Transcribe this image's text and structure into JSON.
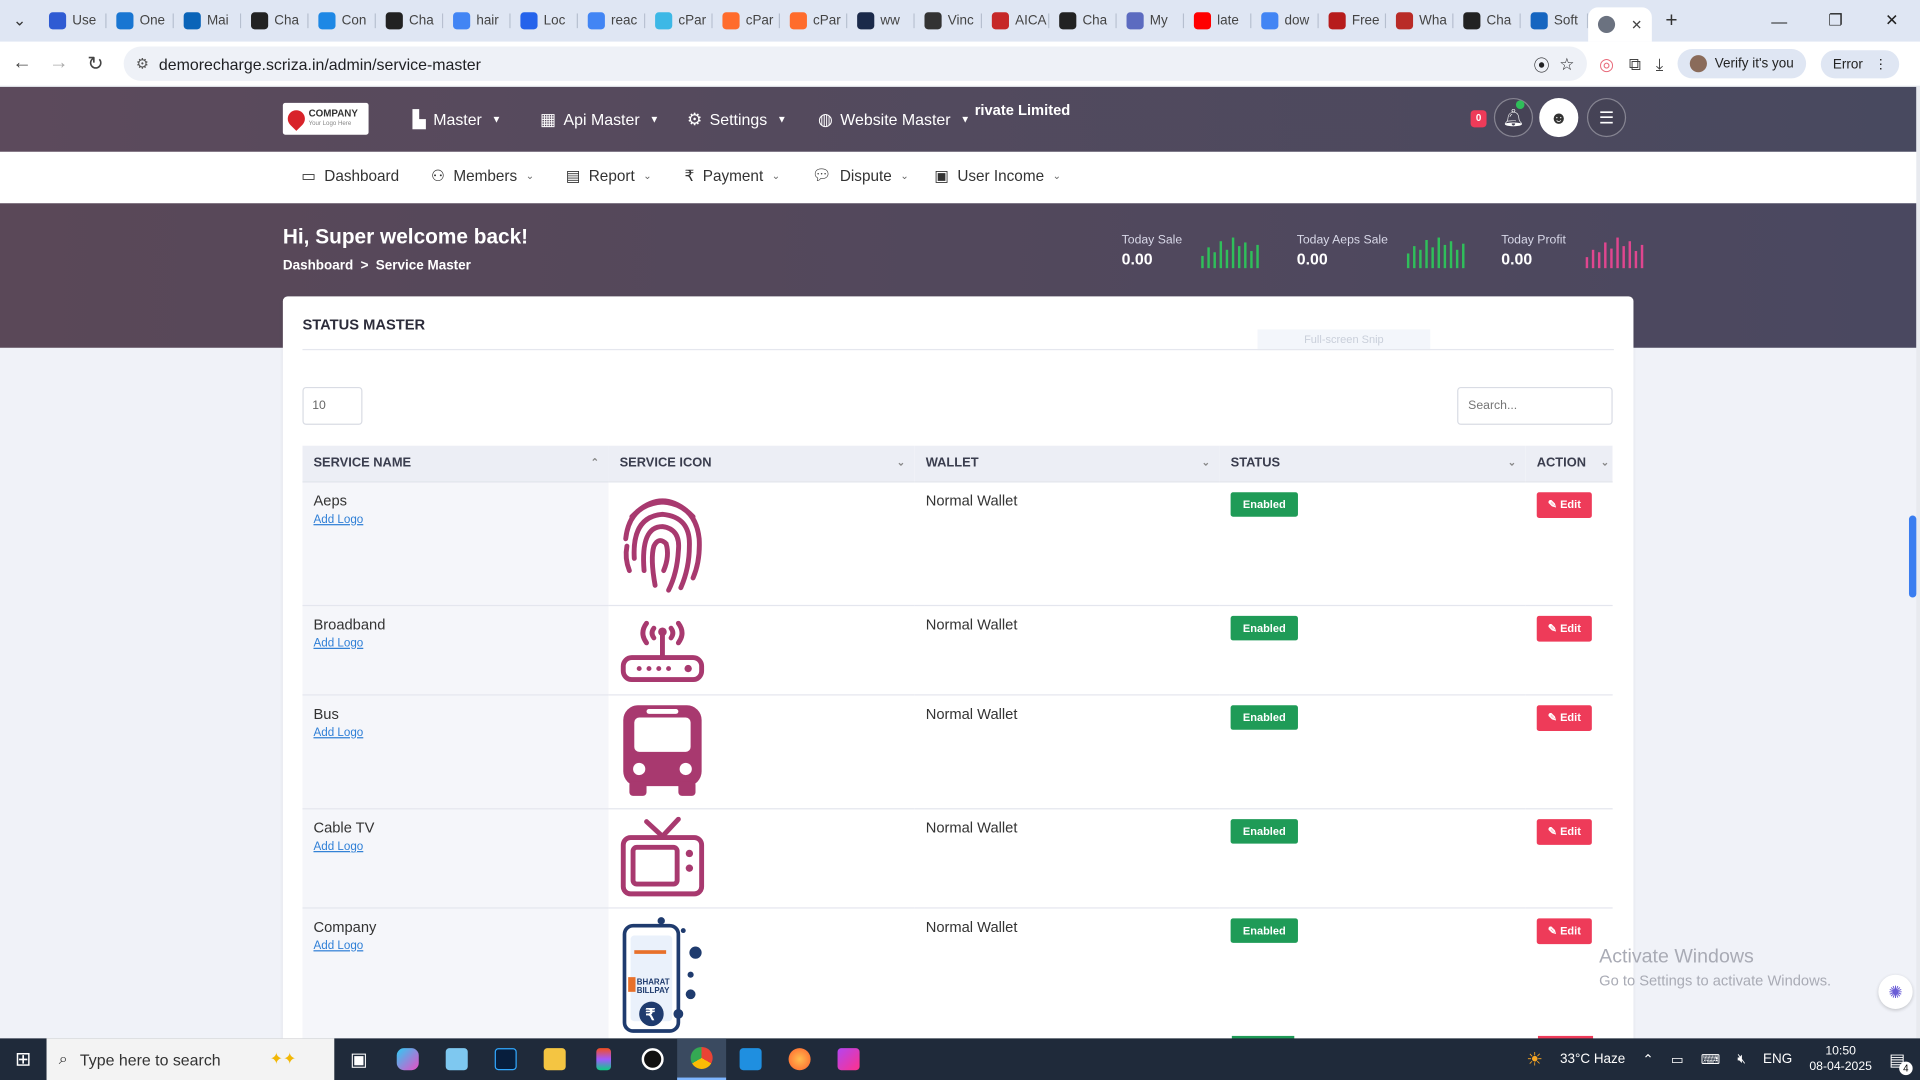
{
  "browser": {
    "tabs": [
      {
        "label": "Use",
        "color": "#2f5bd3"
      },
      {
        "label": "One",
        "color": "#1976d2"
      },
      {
        "label": "Mai",
        "color": "#0a64b8"
      },
      {
        "label": "Cha",
        "color": "#222222"
      },
      {
        "label": "Con",
        "color": "#1e88e5"
      },
      {
        "label": "Cha",
        "color": "#222222"
      },
      {
        "label": "hair",
        "color": "#4285f4"
      },
      {
        "label": "Loc",
        "color": "#2563eb"
      },
      {
        "label": "reac",
        "color": "#4285f4"
      },
      {
        "label": "cPar",
        "color": "#3db8e6"
      },
      {
        "label": "cPar",
        "color": "#ff6c2c"
      },
      {
        "label": "cPar",
        "color": "#ff6c2c"
      },
      {
        "label": "ww",
        "color": "#1b2a4a"
      },
      {
        "label": "Vinc",
        "color": "#333333"
      },
      {
        "label": "AICA",
        "color": "#c62828"
      },
      {
        "label": "Cha",
        "color": "#222222"
      },
      {
        "label": "My",
        "color": "#5c6bc0"
      },
      {
        "label": "late",
        "color": "#ff0000"
      },
      {
        "label": "dow",
        "color": "#4285f4"
      },
      {
        "label": "Free",
        "color": "#b71c1c"
      },
      {
        "label": "Wha",
        "color": "#b92b27"
      },
      {
        "label": "Cha",
        "color": "#222222"
      },
      {
        "label": "Soft",
        "color": "#1565c0"
      }
    ],
    "active_tab_close": "✕",
    "new_tab": "+",
    "url": "demorecharge.scriza.in/admin/service-master",
    "verify_label": "Verify it's you",
    "error_label": "Error"
  },
  "header": {
    "logo_name": "COMPANY",
    "logo_tagline": "Your Logo Here",
    "menus": [
      {
        "label": "Master"
      },
      {
        "label": "Api Master"
      },
      {
        "label": "Settings"
      },
      {
        "label": "Website Master"
      }
    ],
    "brand_text": "rivate Limited",
    "notification_count": "0"
  },
  "subnav": [
    {
      "label": "Dashboard"
    },
    {
      "label": "Members"
    },
    {
      "label": "Report"
    },
    {
      "label": "Payment"
    },
    {
      "label": "Dispute"
    },
    {
      "label": "User Income"
    }
  ],
  "hero": {
    "greeting": "Hi, Super welcome back!",
    "breadcrumb": [
      "Dashboard",
      ">",
      "Service Master"
    ],
    "stats": [
      {
        "label": "Today Sale",
        "value": "0.00",
        "color": "#2fbf5a"
      },
      {
        "label": "Today Aeps Sale",
        "value": "0.00",
        "color": "#2fbf5a"
      },
      {
        "label": "Today Profit",
        "value": "0.00",
        "color": "#e0468f"
      }
    ]
  },
  "card": {
    "title": "STATUS MASTER",
    "ghost_text": "Full-screen Snip",
    "page_length": "10",
    "search_placeholder": "Search...",
    "columns": [
      "SERVICE NAME",
      "SERVICE ICON",
      "WALLET",
      "STATUS",
      "ACTION"
    ],
    "rows": [
      {
        "name": "Aeps",
        "add_logo": "Add Logo",
        "icon": "fingerprint-icon",
        "wallet": "Normal Wallet",
        "status": "Enabled",
        "action": "Edit"
      },
      {
        "name": "Broadband",
        "add_logo": "Add Logo",
        "icon": "router-icon",
        "wallet": "Normal Wallet",
        "status": "Enabled",
        "action": "Edit"
      },
      {
        "name": "Bus",
        "add_logo": "Add Logo",
        "icon": "bus-icon",
        "wallet": "Normal Wallet",
        "status": "Enabled",
        "action": "Edit"
      },
      {
        "name": "Cable TV",
        "add_logo": "Add Logo",
        "icon": "tv-icon",
        "wallet": "Normal Wallet",
        "status": "Enabled",
        "action": "Edit"
      },
      {
        "name": "Company",
        "add_logo": "Add Logo",
        "icon": "bharat-billpay-icon",
        "wallet": "Normal Wallet",
        "status": "Enabled",
        "action": "Edit"
      }
    ],
    "icon_color": "#a8396f",
    "billpay_text": [
      "BHARAT",
      "BILLPAY"
    ]
  },
  "watermark": {
    "line1": "Activate Windows",
    "line2": "Go to Settings to activate Windows."
  },
  "taskbar": {
    "search_placeholder": "Type here to search",
    "weather": "33°C  Haze",
    "language": "ENG",
    "time": "10:50",
    "date": "08-04-2025",
    "notification_count": "4"
  }
}
